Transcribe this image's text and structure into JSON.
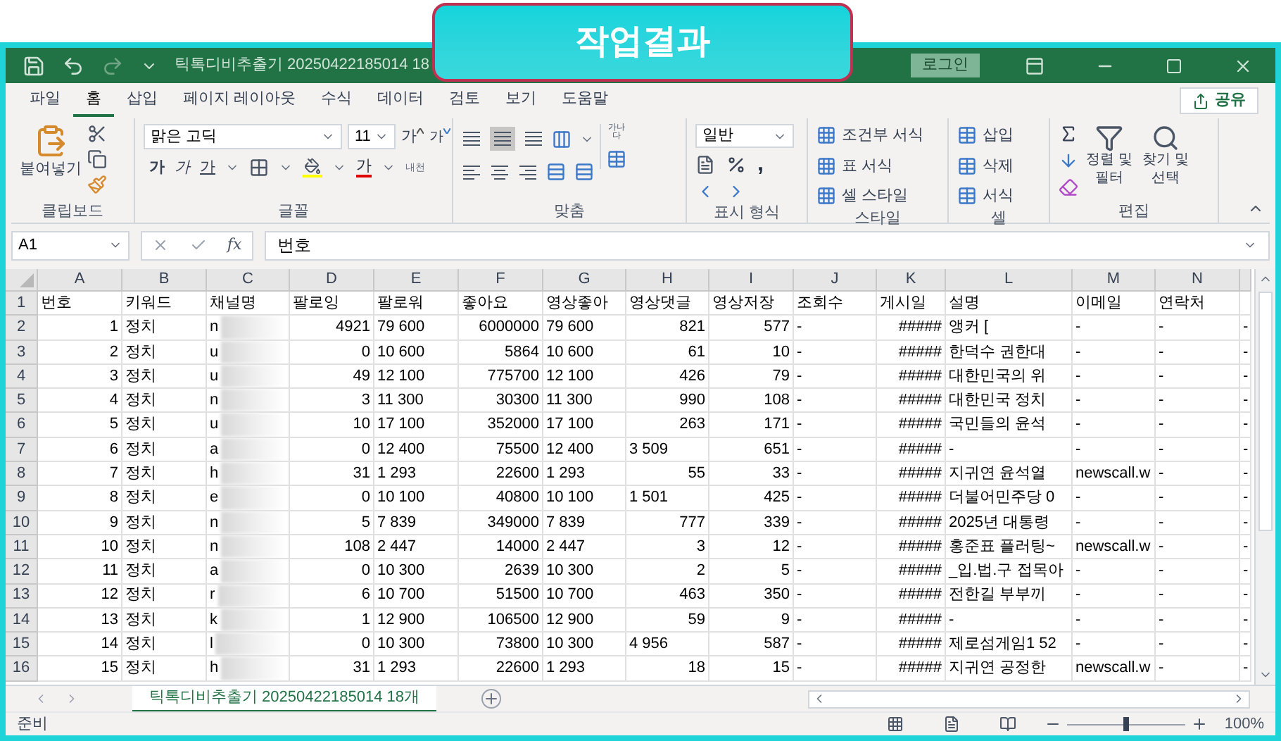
{
  "overlay_banner": {
    "text": "작업결과"
  },
  "title_bar": {
    "title": "틱톡디비추출기 20250422185014 18",
    "login": "로그인"
  },
  "ribbon_tabs": [
    {
      "label": "파일",
      "selected": false
    },
    {
      "label": "홈",
      "selected": true
    },
    {
      "label": "삽입",
      "selected": false
    },
    {
      "label": "페이지 레이아웃",
      "selected": false
    },
    {
      "label": "수식",
      "selected": false
    },
    {
      "label": "데이터",
      "selected": false
    },
    {
      "label": "검토",
      "selected": false
    },
    {
      "label": "보기",
      "selected": false
    },
    {
      "label": "도움말",
      "selected": false
    }
  ],
  "share": "공유",
  "clipboard": {
    "paste": "붙여넣기",
    "label": "클립보드"
  },
  "font": {
    "name": "맑은 고딕",
    "size": "11",
    "grow": "가",
    "shrink": "가",
    "bold": "가",
    "italic": "가",
    "underline": "가",
    "font_color": "가",
    "phonetic": "내천",
    "label": "글꼴"
  },
  "alignment": {
    "wrap": "가나다",
    "label": "맞춤"
  },
  "number": {
    "format": "일반",
    "comma": ",",
    "label": "표시 형식"
  },
  "styles": {
    "items": [
      "조건부 서식",
      "표 서식",
      "셀 스타일"
    ],
    "label": "스타일"
  },
  "cells": {
    "items": [
      "삽입",
      "삭제",
      "서식"
    ],
    "label": "셀"
  },
  "editing": {
    "sort": "정렬 및 필터",
    "find": "찾기 및 선택",
    "label": "편집"
  },
  "formula_bar": {
    "name_box": "A1",
    "function_label": "fx",
    "formula": "번호"
  },
  "sheet": {
    "columns": [
      {
        "letter": "A",
        "numeric": true
      },
      {
        "letter": "B"
      },
      {
        "letter": "C"
      },
      {
        "letter": "D",
        "numeric": true
      },
      {
        "letter": "E",
        "numeric": false
      },
      {
        "letter": "F",
        "numeric": true
      },
      {
        "letter": "G",
        "numeric": false
      },
      {
        "letter": "H",
        "numeric": true
      },
      {
        "letter": "I",
        "numeric": true
      },
      {
        "letter": "J",
        "numeric": false
      },
      {
        "letter": "K",
        "numeric": true
      },
      {
        "letter": "L",
        "numeric": false
      },
      {
        "letter": "M",
        "numeric": false
      },
      {
        "letter": "N",
        "numeric": false
      },
      {
        "numeric": false
      }
    ],
    "header_row": {
      "number": "1",
      "cells": [
        "번호",
        "키워드",
        "채널명",
        "팔로잉",
        "팔로워",
        "좋아요",
        "영상좋아",
        "영상댓글",
        "영상저장",
        "조회수",
        "게시일",
        "설명",
        "이메일",
        "연락처"
      ]
    },
    "rows": [
      {
        "number": "2",
        "cells": [
          "1",
          "정치",
          {
            "text": "n",
            "kind": "redacted"
          },
          "4921",
          "79 600",
          "6000000",
          "79 600",
          "821",
          "577",
          "-",
          "#####",
          "앵커 [",
          "-",
          "-",
          "-"
        ]
      },
      {
        "number": "3",
        "cells": [
          "2",
          "정치",
          {
            "text": "u",
            "kind": "redacted"
          },
          "0",
          "10 600",
          "5864",
          "10 600",
          "61",
          "10",
          "-",
          "#####",
          "한덕수 권한대",
          "-",
          "-",
          "-"
        ]
      },
      {
        "number": "4",
        "cells": [
          "3",
          "정치",
          {
            "text": "u",
            "kind": "redacted"
          },
          "49",
          "12 100",
          "775700",
          "12 100",
          "426",
          "79",
          "-",
          "#####",
          "대한민국의 위",
          "-",
          "-",
          "-"
        ]
      },
      {
        "number": "5",
        "cells": [
          "4",
          "정치",
          {
            "text": "n",
            "kind": "redacted"
          },
          "3",
          "11 300",
          "30300",
          "11 300",
          "990",
          "108",
          "-",
          "#####",
          "대한민국 정치",
          "-",
          "-",
          "-"
        ]
      },
      {
        "number": "6",
        "cells": [
          "5",
          "정치",
          {
            "text": "u",
            "kind": "redacted"
          },
          "10",
          "17 100",
          "352000",
          "17 100",
          "263",
          "171",
          "-",
          "#####",
          "국민들의 윤석",
          "-",
          "-",
          "-"
        ]
      },
      {
        "number": "7",
        "cells": [
          "6",
          "정치",
          {
            "text": "a",
            "kind": "redacted"
          },
          "0",
          "12 400",
          "75500",
          "12 400",
          {
            "text": "3 509",
            "kind": "text"
          },
          "651",
          "-",
          "#####",
          "-",
          "-",
          "-",
          "-"
        ]
      },
      {
        "number": "8",
        "cells": [
          "7",
          "정치",
          {
            "text": "h",
            "kind": "redacted"
          },
          "31",
          "1 293",
          "22600",
          "1 293",
          "55",
          "33",
          "-",
          "#####",
          "지귀연  윤석열",
          "newscall.w",
          "-",
          "-"
        ]
      },
      {
        "number": "9",
        "cells": [
          "8",
          "정치",
          {
            "text": "e",
            "kind": "redacted"
          },
          "0",
          "10 100",
          "40800",
          "10 100",
          {
            "text": "1 501",
            "kind": "text"
          },
          "425",
          "-",
          "#####",
          "더불어민주당 0",
          "-",
          "-",
          "-"
        ]
      },
      {
        "number": "10",
        "cells": [
          "9",
          "정치",
          {
            "text": "n",
            "kind": "redacted"
          },
          "5",
          "7 839",
          "349000",
          "7 839",
          "777",
          "339",
          "-",
          "#####",
          "2025년 대통령",
          "-",
          "-",
          "-"
        ]
      },
      {
        "number": "11",
        "cells": [
          "10",
          "정치",
          {
            "text": "n",
            "kind": "redacted"
          },
          "108",
          "2 447",
          "14000",
          "2 447",
          "3",
          "12",
          "-",
          "#####",
          "홍준표 플러팅~",
          "newscall.w",
          "-",
          "-"
        ]
      },
      {
        "number": "12",
        "cells": [
          "11",
          "정치",
          {
            "text": "a",
            "kind": "redacted"
          },
          "0",
          "10 300",
          "2639",
          "10 300",
          "2",
          "5",
          "-",
          "#####",
          "_입.법.구 접목아",
          "-",
          "-",
          "-"
        ]
      },
      {
        "number": "13",
        "cells": [
          "12",
          "정치",
          {
            "text": "r",
            "kind": "redacted"
          },
          "6",
          "10 700",
          "51500",
          "10 700",
          "463",
          "350",
          "-",
          "#####",
          "전한길  부부끼",
          "-",
          "-",
          "-"
        ]
      },
      {
        "number": "14",
        "cells": [
          "13",
          "정치",
          {
            "text": "k",
            "kind": "redacted"
          },
          "1",
          "12 900",
          "106500",
          "12 900",
          "59",
          "9",
          "-",
          "#####",
          "-",
          "-",
          "-",
          "-"
        ]
      },
      {
        "number": "15",
        "cells": [
          "14",
          "정치",
          {
            "text": "l",
            "kind": "redacted"
          },
          "0",
          "10 300",
          "73800",
          "10 300",
          {
            "text": "4 956",
            "kind": "text"
          },
          "587",
          "-",
          "#####",
          "제로섬게임1 52",
          "-",
          "-",
          "-"
        ]
      },
      {
        "number": "16",
        "cells": [
          "15",
          "정치",
          {
            "text": "h",
            "kind": "redacted"
          },
          "31",
          "1 293",
          "22600",
          "1 293",
          "18",
          "15",
          "-",
          "#####",
          "지귀연  공정한",
          "newscall.w",
          "-",
          "-"
        ]
      }
    ]
  },
  "sheet_tabs": [
    {
      "label": "틱톡디비추출기 20250422185014 18개",
      "selected": true
    }
  ],
  "status_bar": {
    "text": "준비",
    "zoom": {
      "level": 0.5,
      "reading": "100%"
    }
  }
}
